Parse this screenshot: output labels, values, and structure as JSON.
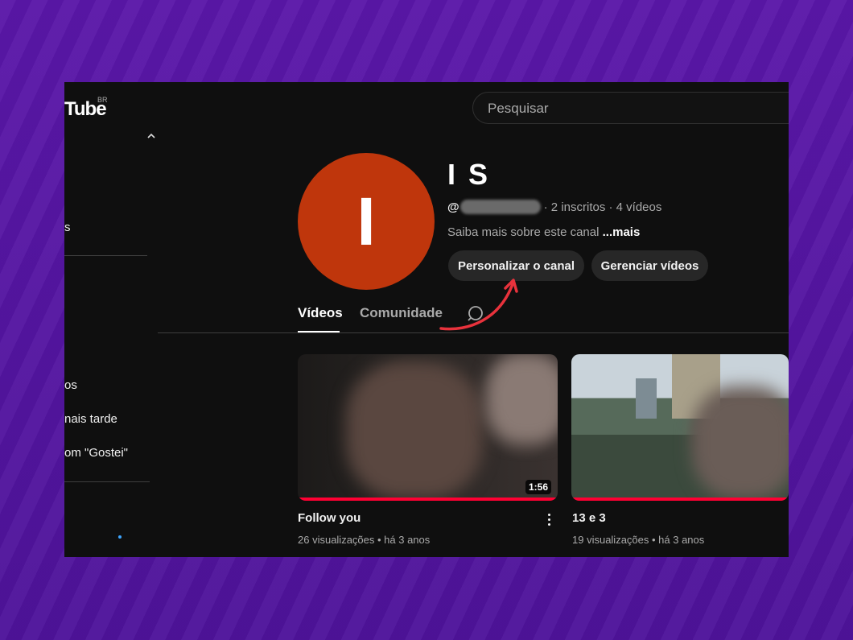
{
  "header": {
    "logo_text": "Tube",
    "logo_country": "BR",
    "search_placeholder": "Pesquisar"
  },
  "sidebar": {
    "items": [
      "s",
      "os",
      "nais tarde",
      "om \"Gostei\""
    ]
  },
  "channel": {
    "avatar_letter": "I",
    "name": "I S",
    "handle_prefix": "@",
    "stats": "· 2 inscritos · 4 vídeos",
    "about": "Saiba mais sobre este canal",
    "about_more": "...mais",
    "customize_label": "Personalizar o canal",
    "manage_label": "Gerenciar vídeos",
    "avatar_color": "#bf360c"
  },
  "tabs": [
    {
      "label": "Vídeos",
      "active": true
    },
    {
      "label": "Comunidade",
      "active": false
    }
  ],
  "videos": [
    {
      "title": "Follow you",
      "meta": "26 visualizações • há 3 anos",
      "duration": "1:56"
    },
    {
      "title": "13 e 3",
      "meta": "19 visualizações • há 3 anos",
      "duration": ""
    }
  ],
  "colors": {
    "background": "#5b16a6",
    "screen": "#0f0f0f",
    "progress": "#ff0033",
    "arrow": "#e8323c"
  }
}
